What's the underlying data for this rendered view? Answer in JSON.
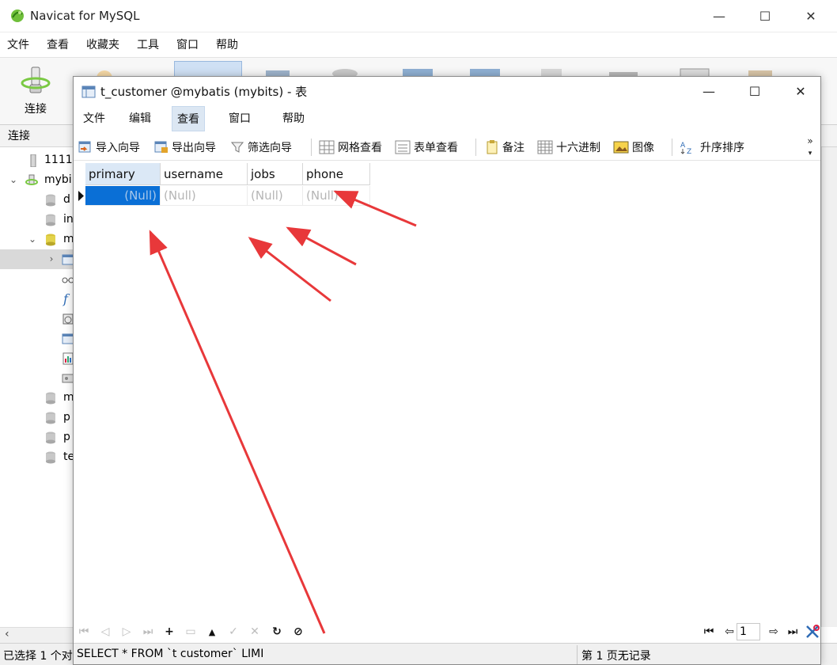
{
  "main_window": {
    "title": "Navicat for MySQL",
    "menu": [
      "文件",
      "查看",
      "收藏夹",
      "工具",
      "窗口",
      "帮助"
    ],
    "toolbar": {
      "connect_label": "连接"
    },
    "connections_header": "连接",
    "tree": [
      {
        "label": "1111"
      },
      {
        "label": "mybi"
      },
      {
        "label": "d"
      },
      {
        "label": "in"
      },
      {
        "label": "m"
      },
      {
        "label": ""
      },
      {
        "label": ""
      },
      {
        "label": ""
      },
      {
        "label": ""
      },
      {
        "label": ""
      },
      {
        "label": ""
      },
      {
        "label": ""
      },
      {
        "label": "m"
      },
      {
        "label": "p"
      },
      {
        "label": "p"
      },
      {
        "label": "te"
      }
    ],
    "status_text": "已选择 1 个对"
  },
  "table_window": {
    "title": "t_customer @mybatis (mybits) - 表",
    "menu": [
      "文件",
      "编辑",
      "查看",
      "窗口",
      "帮助"
    ],
    "active_menu": "查看",
    "toolbar": {
      "import": "导入向导",
      "export": "导出向导",
      "filter": "筛选向导",
      "grid_view": "网格查看",
      "form_view": "表单查看",
      "memo": "备注",
      "hex": "十六进制",
      "image": "图像",
      "sort_asc": "升序排序",
      "overflow": "»"
    },
    "grid": {
      "columns": [
        "primary",
        "username",
        "jobs",
        "phone"
      ],
      "rows": [
        [
          "(Null)",
          "(Null)",
          "(Null)",
          "(Null)"
        ]
      ]
    },
    "pager": {
      "page_value": "1"
    },
    "status": {
      "sql": "SELECT * FROM `t customer` LIMI",
      "page_info": "第 1 页无记录"
    }
  },
  "colors": {
    "selection": "#0a6fd6",
    "header_selected": "#dbe8f6",
    "annotation_arrow": "#e8383a"
  }
}
